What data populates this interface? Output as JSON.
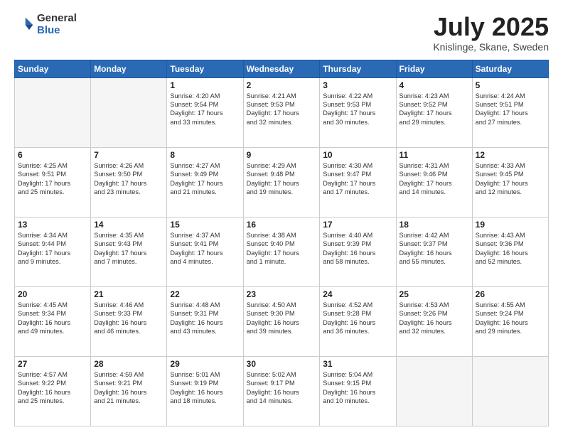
{
  "logo": {
    "general": "General",
    "blue": "Blue"
  },
  "header": {
    "month": "July 2025",
    "location": "Knislinge, Skane, Sweden"
  },
  "days_of_week": [
    "Sunday",
    "Monday",
    "Tuesday",
    "Wednesday",
    "Thursday",
    "Friday",
    "Saturday"
  ],
  "weeks": [
    [
      {
        "day": "",
        "detail": ""
      },
      {
        "day": "",
        "detail": ""
      },
      {
        "day": "1",
        "detail": "Sunrise: 4:20 AM\nSunset: 9:54 PM\nDaylight: 17 hours\nand 33 minutes."
      },
      {
        "day": "2",
        "detail": "Sunrise: 4:21 AM\nSunset: 9:53 PM\nDaylight: 17 hours\nand 32 minutes."
      },
      {
        "day": "3",
        "detail": "Sunrise: 4:22 AM\nSunset: 9:53 PM\nDaylight: 17 hours\nand 30 minutes."
      },
      {
        "day": "4",
        "detail": "Sunrise: 4:23 AM\nSunset: 9:52 PM\nDaylight: 17 hours\nand 29 minutes."
      },
      {
        "day": "5",
        "detail": "Sunrise: 4:24 AM\nSunset: 9:51 PM\nDaylight: 17 hours\nand 27 minutes."
      }
    ],
    [
      {
        "day": "6",
        "detail": "Sunrise: 4:25 AM\nSunset: 9:51 PM\nDaylight: 17 hours\nand 25 minutes."
      },
      {
        "day": "7",
        "detail": "Sunrise: 4:26 AM\nSunset: 9:50 PM\nDaylight: 17 hours\nand 23 minutes."
      },
      {
        "day": "8",
        "detail": "Sunrise: 4:27 AM\nSunset: 9:49 PM\nDaylight: 17 hours\nand 21 minutes."
      },
      {
        "day": "9",
        "detail": "Sunrise: 4:29 AM\nSunset: 9:48 PM\nDaylight: 17 hours\nand 19 minutes."
      },
      {
        "day": "10",
        "detail": "Sunrise: 4:30 AM\nSunset: 9:47 PM\nDaylight: 17 hours\nand 17 minutes."
      },
      {
        "day": "11",
        "detail": "Sunrise: 4:31 AM\nSunset: 9:46 PM\nDaylight: 17 hours\nand 14 minutes."
      },
      {
        "day": "12",
        "detail": "Sunrise: 4:33 AM\nSunset: 9:45 PM\nDaylight: 17 hours\nand 12 minutes."
      }
    ],
    [
      {
        "day": "13",
        "detail": "Sunrise: 4:34 AM\nSunset: 9:44 PM\nDaylight: 17 hours\nand 9 minutes."
      },
      {
        "day": "14",
        "detail": "Sunrise: 4:35 AM\nSunset: 9:43 PM\nDaylight: 17 hours\nand 7 minutes."
      },
      {
        "day": "15",
        "detail": "Sunrise: 4:37 AM\nSunset: 9:41 PM\nDaylight: 17 hours\nand 4 minutes."
      },
      {
        "day": "16",
        "detail": "Sunrise: 4:38 AM\nSunset: 9:40 PM\nDaylight: 17 hours\nand 1 minute."
      },
      {
        "day": "17",
        "detail": "Sunrise: 4:40 AM\nSunset: 9:39 PM\nDaylight: 16 hours\nand 58 minutes."
      },
      {
        "day": "18",
        "detail": "Sunrise: 4:42 AM\nSunset: 9:37 PM\nDaylight: 16 hours\nand 55 minutes."
      },
      {
        "day": "19",
        "detail": "Sunrise: 4:43 AM\nSunset: 9:36 PM\nDaylight: 16 hours\nand 52 minutes."
      }
    ],
    [
      {
        "day": "20",
        "detail": "Sunrise: 4:45 AM\nSunset: 9:34 PM\nDaylight: 16 hours\nand 49 minutes."
      },
      {
        "day": "21",
        "detail": "Sunrise: 4:46 AM\nSunset: 9:33 PM\nDaylight: 16 hours\nand 46 minutes."
      },
      {
        "day": "22",
        "detail": "Sunrise: 4:48 AM\nSunset: 9:31 PM\nDaylight: 16 hours\nand 43 minutes."
      },
      {
        "day": "23",
        "detail": "Sunrise: 4:50 AM\nSunset: 9:30 PM\nDaylight: 16 hours\nand 39 minutes."
      },
      {
        "day": "24",
        "detail": "Sunrise: 4:52 AM\nSunset: 9:28 PM\nDaylight: 16 hours\nand 36 minutes."
      },
      {
        "day": "25",
        "detail": "Sunrise: 4:53 AM\nSunset: 9:26 PM\nDaylight: 16 hours\nand 32 minutes."
      },
      {
        "day": "26",
        "detail": "Sunrise: 4:55 AM\nSunset: 9:24 PM\nDaylight: 16 hours\nand 29 minutes."
      }
    ],
    [
      {
        "day": "27",
        "detail": "Sunrise: 4:57 AM\nSunset: 9:22 PM\nDaylight: 16 hours\nand 25 minutes."
      },
      {
        "day": "28",
        "detail": "Sunrise: 4:59 AM\nSunset: 9:21 PM\nDaylight: 16 hours\nand 21 minutes."
      },
      {
        "day": "29",
        "detail": "Sunrise: 5:01 AM\nSunset: 9:19 PM\nDaylight: 16 hours\nand 18 minutes."
      },
      {
        "day": "30",
        "detail": "Sunrise: 5:02 AM\nSunset: 9:17 PM\nDaylight: 16 hours\nand 14 minutes."
      },
      {
        "day": "31",
        "detail": "Sunrise: 5:04 AM\nSunset: 9:15 PM\nDaylight: 16 hours\nand 10 minutes."
      },
      {
        "day": "",
        "detail": ""
      },
      {
        "day": "",
        "detail": ""
      }
    ]
  ]
}
